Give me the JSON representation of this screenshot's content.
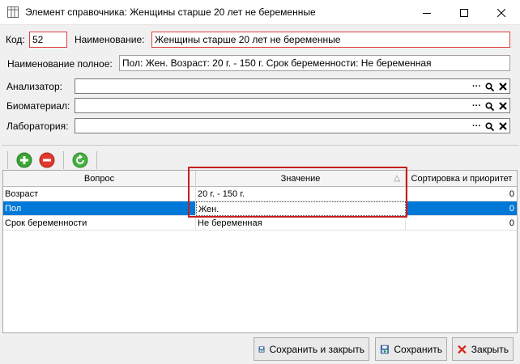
{
  "window": {
    "title": "Элемент справочника: Женщины старше 20 лет не беременные",
    "icon": "table-icon",
    "controls": [
      "minimize-icon",
      "maximize-icon",
      "close-icon"
    ]
  },
  "form": {
    "code_label": "Код:",
    "code_value": "52",
    "name_label": "Наименование:",
    "name_value": "Женщины старше 20 лет не беременные",
    "fullname_label": "Наименование полное:",
    "fullname_value": "Пол: Жен. Возраст: 20 г. - 150 г.  Срок беременности: Не беременная",
    "analyzer_label": "Анализатор:",
    "analyzer_value": "",
    "biomaterial_label": "Биоматериал:",
    "biomaterial_value": "",
    "laboratory_label": "Лаборатория:",
    "laboratory_value": "",
    "lookup_button_glyphs": [
      "···",
      "search-icon",
      "close-icon"
    ]
  },
  "toolbar": {
    "buttons": [
      "add-icon",
      "remove-icon",
      "refresh-icon"
    ]
  },
  "grid": {
    "columns": [
      "Вопрос",
      "Значение",
      "Сортировка и приоритет"
    ],
    "sort_indicator": "△",
    "rows": [
      {
        "question": "Возраст",
        "value": "20 г. - 150 г.",
        "priority": "0",
        "selected": false
      },
      {
        "question": "Пол",
        "value": "Жен.",
        "priority": "0",
        "selected": true
      },
      {
        "question": "Срок беременности",
        "value": "Не беременная",
        "priority": "0",
        "selected": false
      }
    ]
  },
  "buttons": {
    "save_close": "Сохранить и закрыть",
    "save": "Сохранить",
    "close": "Закрыть"
  },
  "colors": {
    "selection": "#0078d7",
    "annotation": "#c81e1e",
    "required_border": "#e04040"
  }
}
